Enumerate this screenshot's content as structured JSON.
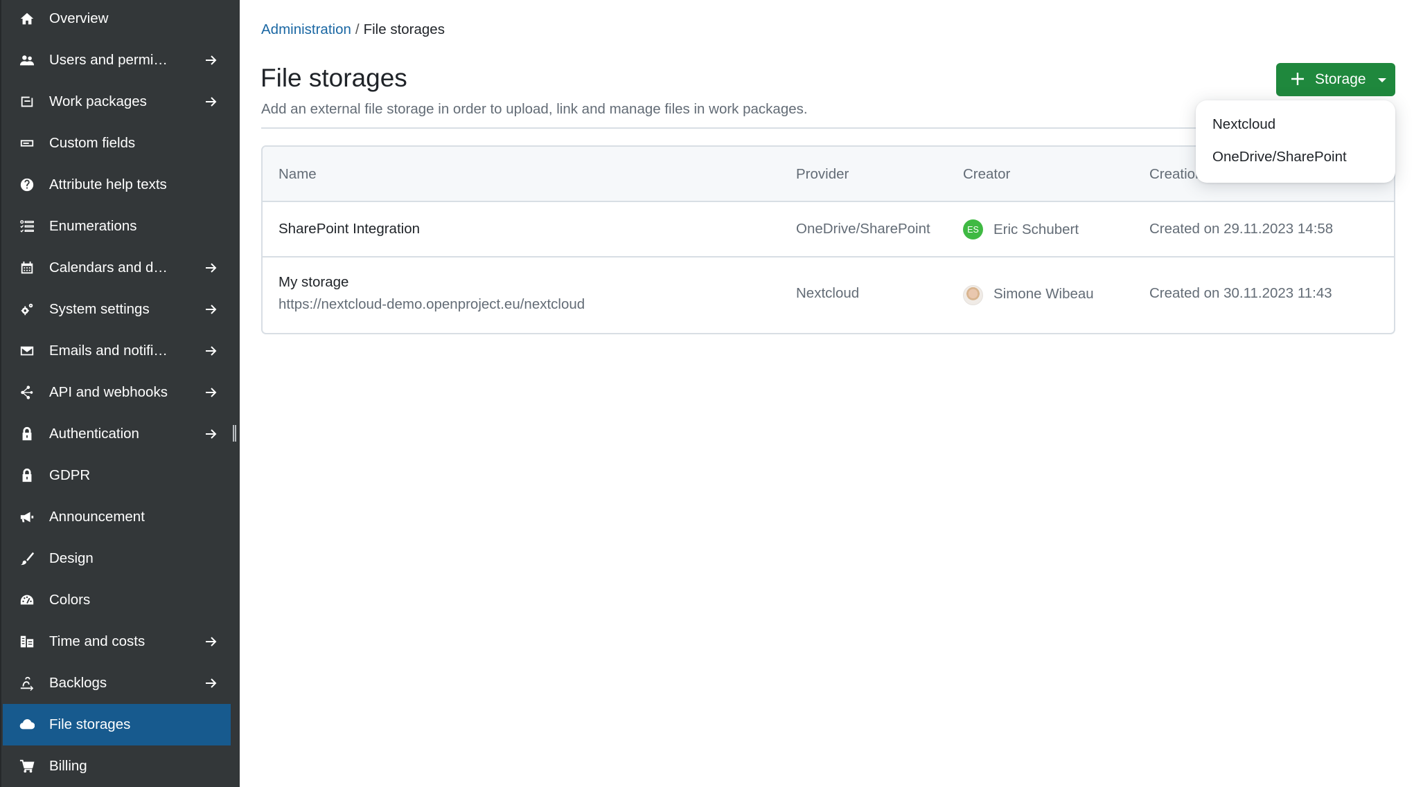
{
  "sidebar": {
    "items": [
      {
        "label": "Overview",
        "icon": "home-icon",
        "has_arrow": false,
        "active": false
      },
      {
        "label": "Users and permi…",
        "icon": "users-icon",
        "has_arrow": true,
        "active": false
      },
      {
        "label": "Work packages",
        "icon": "work-packages-icon",
        "has_arrow": true,
        "active": false
      },
      {
        "label": "Custom fields",
        "icon": "custom-fields-icon",
        "has_arrow": false,
        "active": false
      },
      {
        "label": "Attribute help texts",
        "icon": "help-icon",
        "has_arrow": false,
        "active": false
      },
      {
        "label": "Enumerations",
        "icon": "enumerations-icon",
        "has_arrow": false,
        "active": false
      },
      {
        "label": "Calendars and d…",
        "icon": "calendar-icon",
        "has_arrow": true,
        "active": false
      },
      {
        "label": "System settings",
        "icon": "settings-icon",
        "has_arrow": true,
        "active": false
      },
      {
        "label": "Emails and notifi…",
        "icon": "mail-icon",
        "has_arrow": true,
        "active": false
      },
      {
        "label": "API and webhooks",
        "icon": "webhook-icon",
        "has_arrow": true,
        "active": false
      },
      {
        "label": "Authentication",
        "icon": "lock-icon",
        "has_arrow": true,
        "active": false
      },
      {
        "label": "GDPR",
        "icon": "lock-icon",
        "has_arrow": false,
        "active": false
      },
      {
        "label": "Announcement",
        "icon": "megaphone-icon",
        "has_arrow": false,
        "active": false
      },
      {
        "label": "Design",
        "icon": "brush-icon",
        "has_arrow": false,
        "active": false
      },
      {
        "label": "Colors",
        "icon": "gauge-icon",
        "has_arrow": false,
        "active": false
      },
      {
        "label": "Time and costs",
        "icon": "budget-icon",
        "has_arrow": true,
        "active": false
      },
      {
        "label": "Backlogs",
        "icon": "backlogs-icon",
        "has_arrow": true,
        "active": false
      },
      {
        "label": "File storages",
        "icon": "cloud-icon",
        "has_arrow": false,
        "active": true
      },
      {
        "label": "Billing",
        "icon": "cart-icon",
        "has_arrow": false,
        "active": false
      }
    ]
  },
  "breadcrumb": {
    "parent": "Administration",
    "separator": "/",
    "current": "File storages"
  },
  "header": {
    "title": "File storages",
    "description": "Add an external file storage in order to upload, link and manage files in work packages.",
    "add_button_label": "Storage"
  },
  "dropdown": {
    "items": [
      "Nextcloud",
      "OneDrive/SharePoint"
    ]
  },
  "table": {
    "columns": [
      "Name",
      "Provider",
      "Creator",
      "Creation"
    ],
    "rows": [
      {
        "name": "SharePoint Integration",
        "url": "",
        "provider": "OneDrive/SharePoint",
        "creator": "Eric Schubert",
        "creator_initials": "ES",
        "creator_avatar_color": "#3fb943",
        "created": "Created on 29.11.2023 14:58"
      },
      {
        "name": "My storage",
        "url": "https://nextcloud-demo.openproject.eu/nextcloud",
        "provider": "Nextcloud",
        "creator": "Simone Wibeau",
        "creator_initials": "",
        "creator_avatar_color": "",
        "created": "Created on 30.11.2023 11:43"
      }
    ]
  },
  "colors": {
    "sidebar_bg": "#333739",
    "sidebar_active": "#175a8e",
    "primary_button": "#1f883d",
    "link": "#1a67a3"
  }
}
